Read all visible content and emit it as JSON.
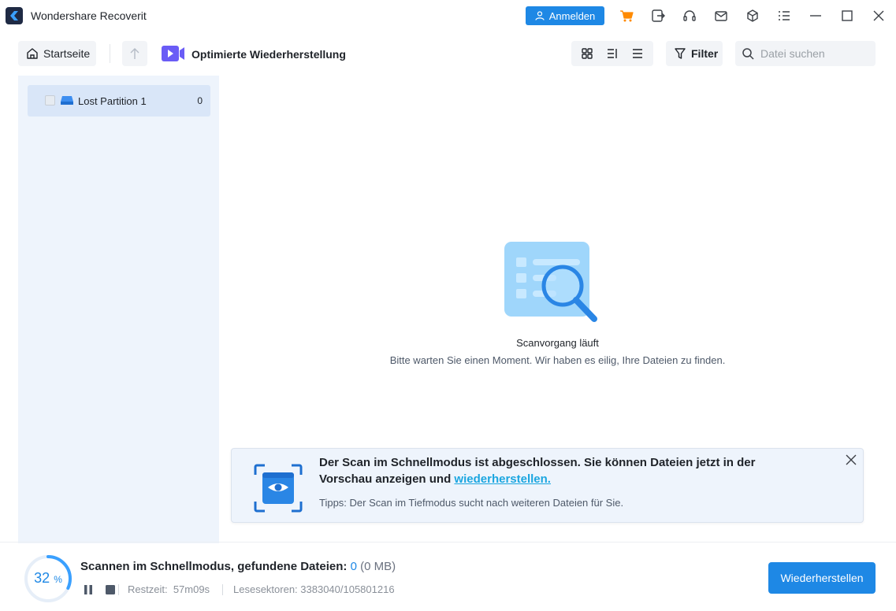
{
  "app": {
    "title": "Wondershare Recoverit",
    "login_label": "Anmelden",
    "brand_color": "#1e88e5"
  },
  "titlebar_icons": [
    "cart-icon",
    "export-icon",
    "headset-icon",
    "mail-icon",
    "cube-icon",
    "list-menu-icon",
    "minimize-icon",
    "maximize-icon",
    "close-icon"
  ],
  "toolbar": {
    "home_label": "Startseite",
    "mode_label": "Optimierte Wiederherstellung",
    "filter_label": "Filter",
    "search_placeholder": "Datei suchen"
  },
  "sidebar": {
    "items": [
      {
        "label": "Lost Partition 1",
        "count": "0",
        "checked": false
      }
    ]
  },
  "main": {
    "status_title": "Scanvorgang läuft",
    "status_subtitle": "Bitte warten Sie einen Moment. Wir haben es eilig, Ihre Dateien zu finden."
  },
  "notification": {
    "text_before_link": "Der Scan im Schnellmodus ist abgeschlossen. Sie können Dateien jetzt in der Vorschau anzeigen und ",
    "link_text": "wiederherstellen.",
    "tip": "Tipps: Der Scan im Tiefmodus sucht nach weiteren Dateien für Sie."
  },
  "bottom": {
    "progress_value": "32",
    "progress_unit": "%",
    "progress_fraction": 0.32,
    "status_label": "Scannen im Schnellmodus, gefundene Dateien: ",
    "files_found": "0",
    "size": "(0 MB)",
    "remaining_label": "Restzeit:",
    "remaining_value": "57m09s",
    "sectors_label": "Lesesektoren: 3383040/105801216",
    "recover_label": "Wiederherstellen"
  }
}
